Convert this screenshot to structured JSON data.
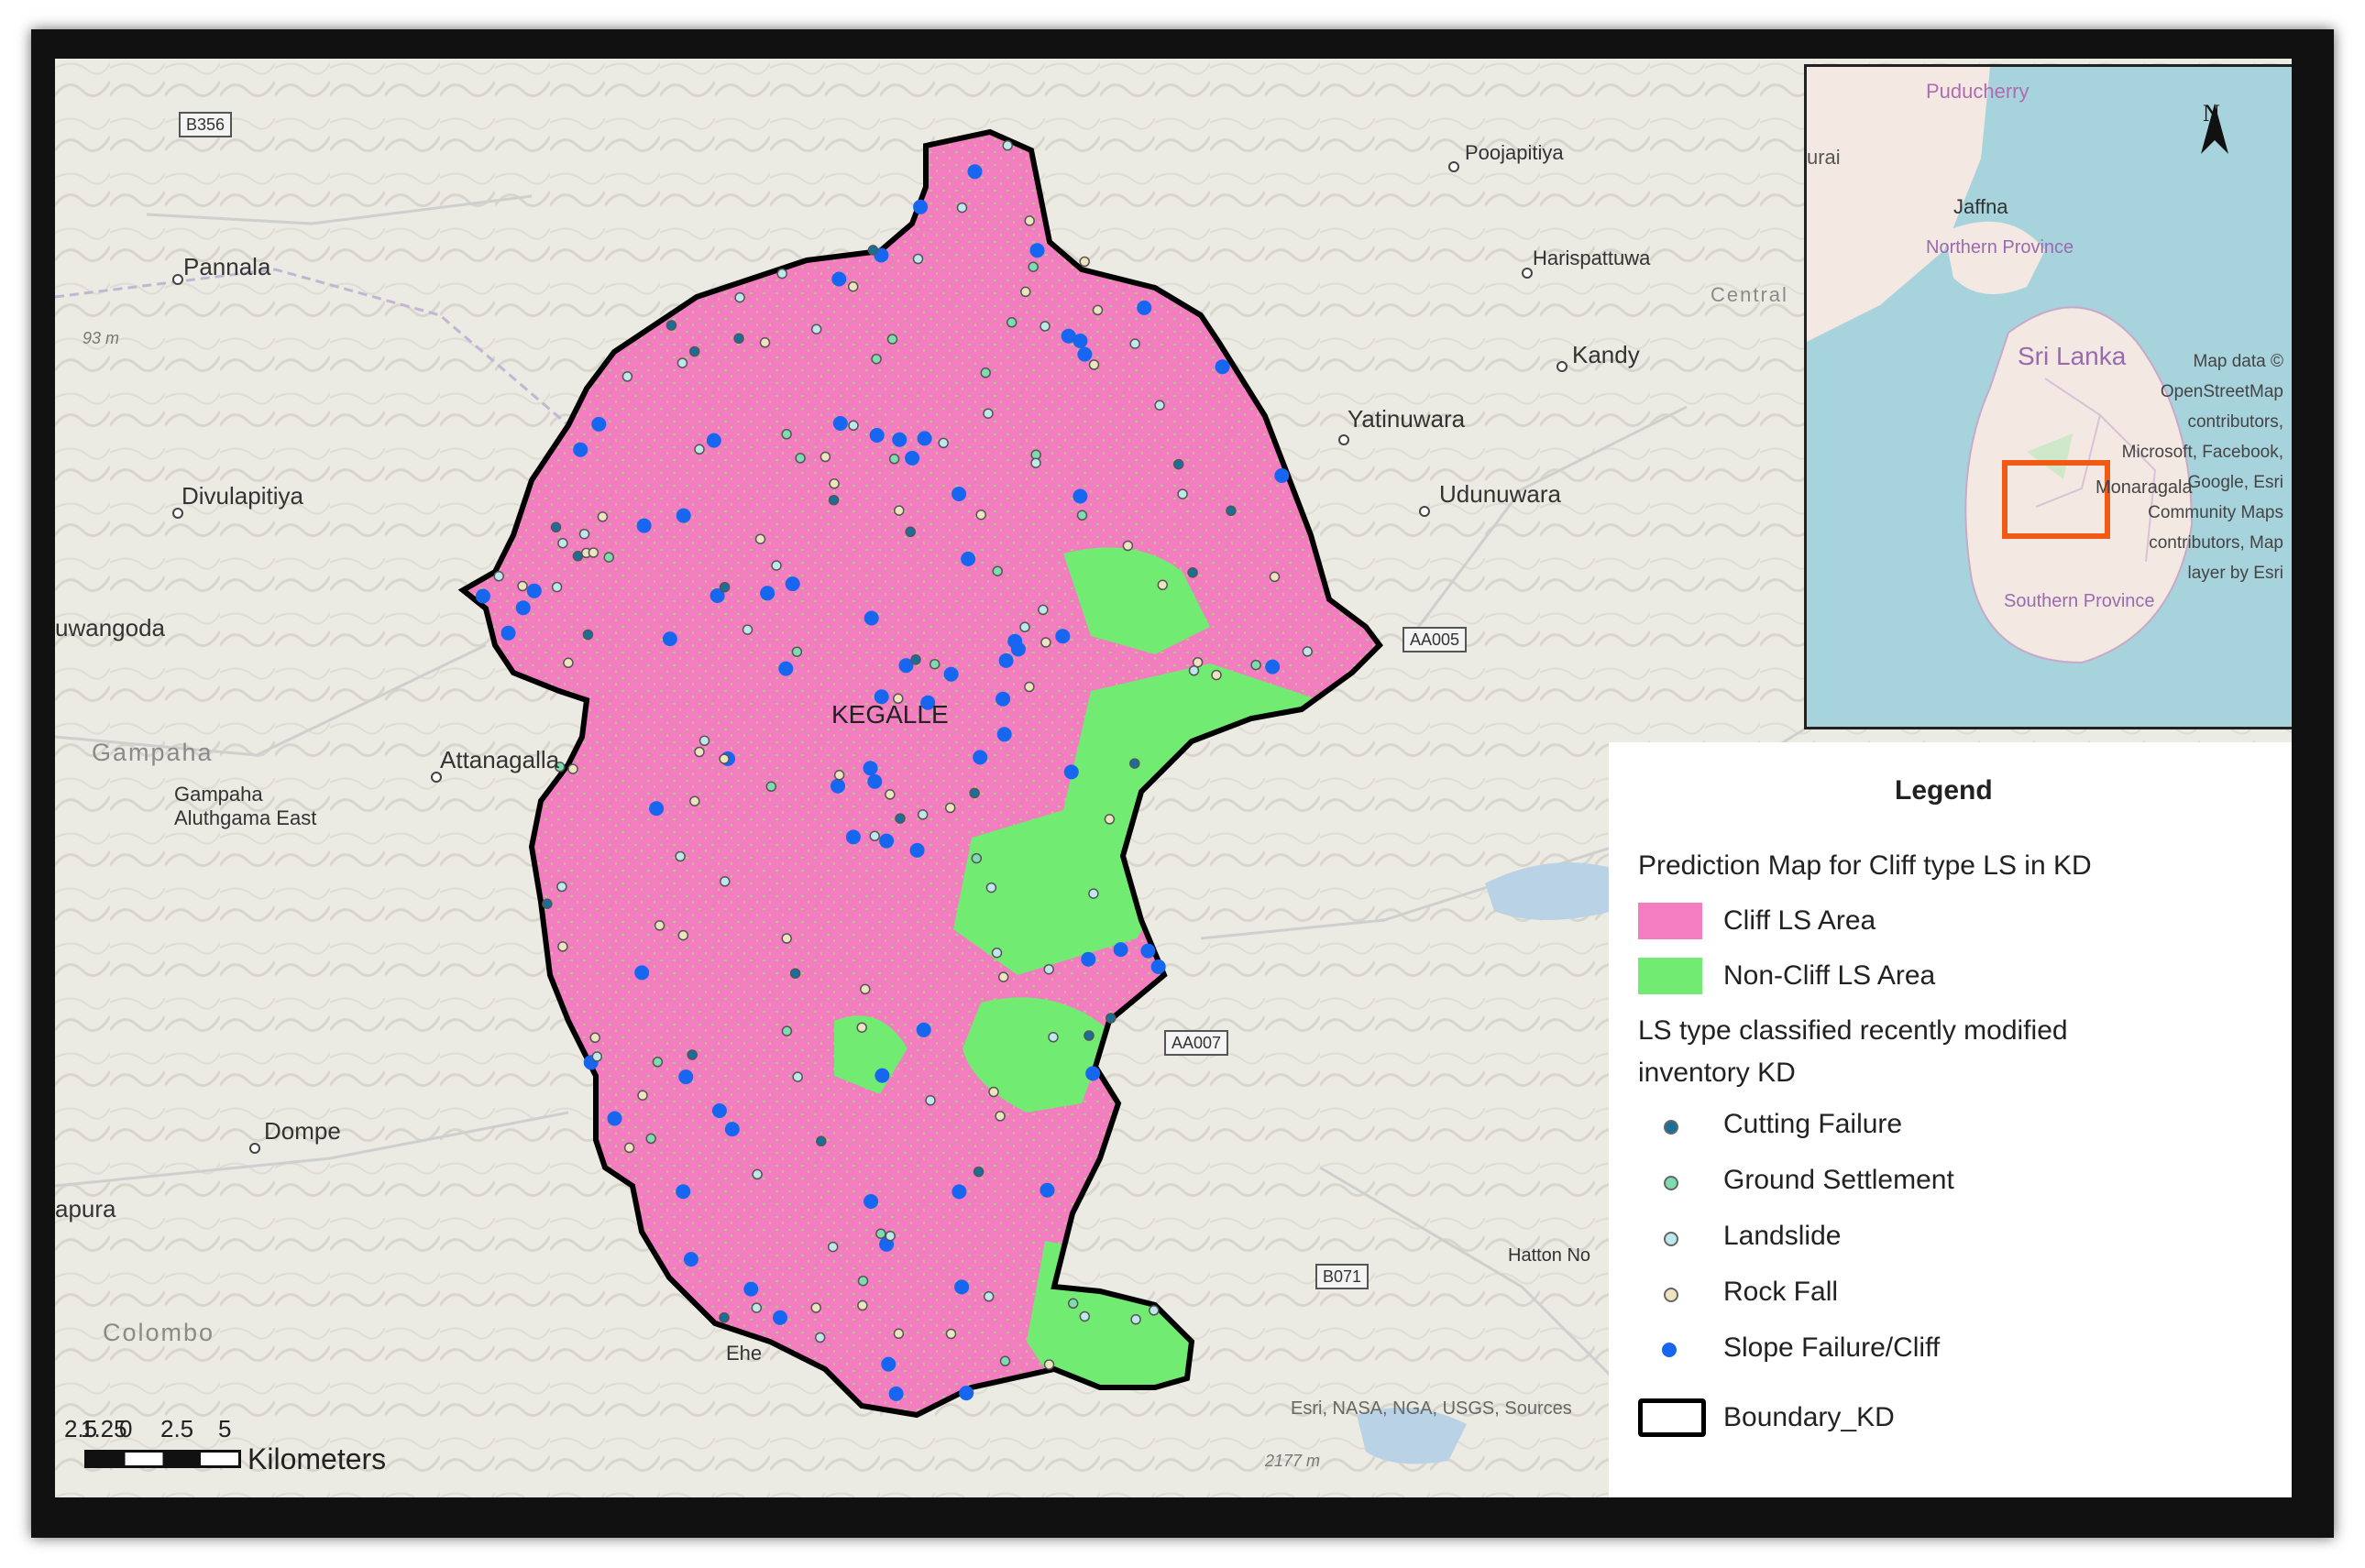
{
  "map": {
    "place_labels": [
      "Pannala",
      "Divulapitiya",
      "uwangoda",
      "Gampaha",
      "Attanagalla",
      "Gampaha Aluthgama East",
      "Dompe",
      "apura",
      "Colombo",
      "Poojapitiya",
      "Harispattuwa",
      "Kandy",
      "Yatinuwara",
      "Udunuwara",
      "Central",
      "KEGALLE",
      "Hatton No",
      "Ehe"
    ],
    "road_labels": [
      "B356",
      "AA005",
      "AA007",
      "B071"
    ],
    "elevation_labels": [
      "93 m",
      "2177 m"
    ],
    "attribution": "Esri, NASA, NGA, USGS, Sources",
    "colors": {
      "cliff": "#f47cc0",
      "noncliff": "#72eb72",
      "boundary": "#000000",
      "slope": "#1666f0"
    },
    "points": {
      "slope_failure_cliff": 80,
      "other_inventory": 150
    }
  },
  "inset": {
    "labels": [
      "Puducherry",
      "urai",
      "Jaffna",
      "Northern Province",
      "Sri Lanka",
      "Monaragala",
      "Southern Province"
    ],
    "north_label": "N",
    "attribution": "Map data © OpenStreetMap contributors, Microsoft, Facebook, Google, Esri Community Maps contributors, Map layer by Esri"
  },
  "legend": {
    "title": "Legend",
    "group1_title": "Prediction Map for Cliff type LS in KD",
    "cliff_label": "Cliff LS Area",
    "noncliff_label": "Non-Cliff LS Area",
    "group2_title_line1": "LS type classified recently modified",
    "group2_title_line2": "inventory KD",
    "items": [
      {
        "label": "Cutting Failure",
        "color": "#1a6f9a"
      },
      {
        "label": "Ground Settlement",
        "color": "#7fdcb0"
      },
      {
        "label": "Landslide",
        "color": "#bfe8ec"
      },
      {
        "label": "Rock Fall",
        "color": "#efe4c0"
      },
      {
        "label": "Slope Failure/Cliff",
        "color": "#1666f0"
      }
    ],
    "boundary_label": "Boundary_KD"
  },
  "scale_bar": {
    "ticks": [
      "2.5",
      "1.25",
      "0",
      "2.5",
      "5"
    ],
    "unit": "Kilometers"
  }
}
